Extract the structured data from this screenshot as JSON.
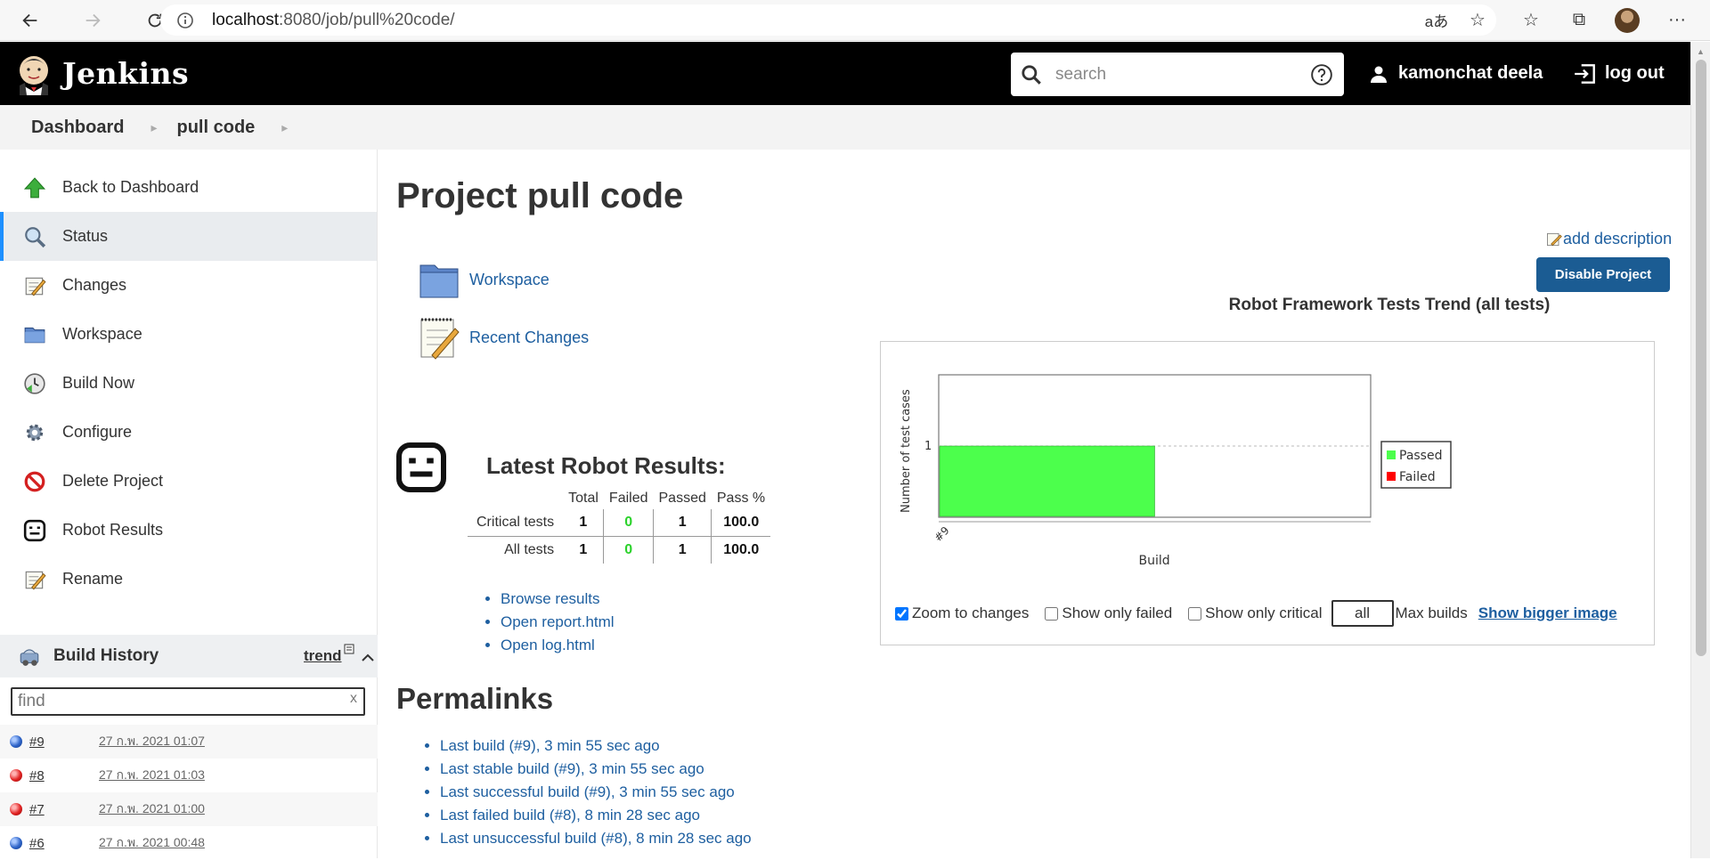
{
  "browser": {
    "url_host": "localhost",
    "url_path": ":8080/job/pull%20code/"
  },
  "header": {
    "brand": "Jenkins",
    "search_placeholder": "search",
    "user_name": "kamonchat deela",
    "logout_label": "log out"
  },
  "breadcrumb": {
    "items": [
      "Dashboard",
      "pull code"
    ]
  },
  "sidebar": {
    "tasks": [
      {
        "label": "Back to Dashboard",
        "icon": "up-arrow-icon"
      },
      {
        "label": "Status",
        "icon": "magnifier-icon",
        "active": true
      },
      {
        "label": "Changes",
        "icon": "notepad-icon"
      },
      {
        "label": "Workspace",
        "icon": "folder-icon"
      },
      {
        "label": "Build Now",
        "icon": "clock-play-icon"
      },
      {
        "label": "Configure",
        "icon": "gear-icon"
      },
      {
        "label": "Delete Project",
        "icon": "no-entry-icon"
      },
      {
        "label": "Robot Results",
        "icon": "robot-icon"
      },
      {
        "label": "Rename",
        "icon": "notepad-icon"
      }
    ]
  },
  "build_history": {
    "title": "Build History",
    "trend_label": "trend",
    "find_placeholder": "find",
    "clear_label": "x",
    "builds": [
      {
        "num": "#9",
        "date": "27 ก.พ. 2021 01:07",
        "status": "success"
      },
      {
        "num": "#8",
        "date": "27 ก.พ. 2021 01:03",
        "status": "failed"
      },
      {
        "num": "#7",
        "date": "27 ก.พ. 2021 01:00",
        "status": "failed"
      },
      {
        "num": "#6",
        "date": "27 ก.พ. 2021 00:48",
        "status": "success"
      }
    ]
  },
  "main": {
    "title": "Project pull code",
    "add_description": "add description",
    "disable_button": "Disable Project",
    "workspace_link": "Workspace",
    "recent_changes_link": "Recent Changes",
    "robot_heading": "Latest Robot Results:",
    "results_headers": [
      "Total",
      "Failed",
      "Passed",
      "Pass %"
    ],
    "results_rows": [
      {
        "label": "Critical tests",
        "total": "1",
        "failed": "0",
        "passed": "1",
        "pass_pct": "100.0"
      },
      {
        "label": "All tests",
        "total": "1",
        "failed": "0",
        "passed": "1",
        "pass_pct": "100.0"
      }
    ],
    "result_links": [
      "Browse results",
      "Open report.html",
      "Open log.html"
    ],
    "permalinks_title": "Permalinks",
    "permalinks": [
      "Last build (#9), 3 min 55 sec ago",
      "Last stable build (#9), 3 min 55 sec ago",
      "Last successful build (#9), 3 min 55 sec ago",
      "Last failed build (#8), 8 min 28 sec ago",
      "Last unsuccessful build (#8), 8 min 28 sec ago"
    ]
  },
  "trend_chart": {
    "title": "Robot Framework Tests Trend (all tests)",
    "controls": {
      "zoom_label": "Zoom to changes",
      "zoom_checked": true,
      "only_failed_label": "Show only failed",
      "only_critical_label": "Show only critical",
      "max_builds_value": "all",
      "max_builds_label": "Max builds",
      "bigger_image_label": "Show bigger image"
    }
  },
  "chart_data": {
    "type": "area",
    "title": "Robot Framework Tests Trend (all tests)",
    "xlabel": "Build",
    "ylabel": "Number of test cases",
    "categories": [
      "#9"
    ],
    "series": [
      {
        "name": "Passed",
        "values": [
          1
        ],
        "color": "#4cff4c"
      },
      {
        "name": "Failed",
        "values": [
          0
        ],
        "color": "#ff0000"
      }
    ],
    "yticks": [
      "1"
    ],
    "legend": "right",
    "colors": {
      "passed": "#4cff4c",
      "failed": "#ff0000"
    }
  }
}
